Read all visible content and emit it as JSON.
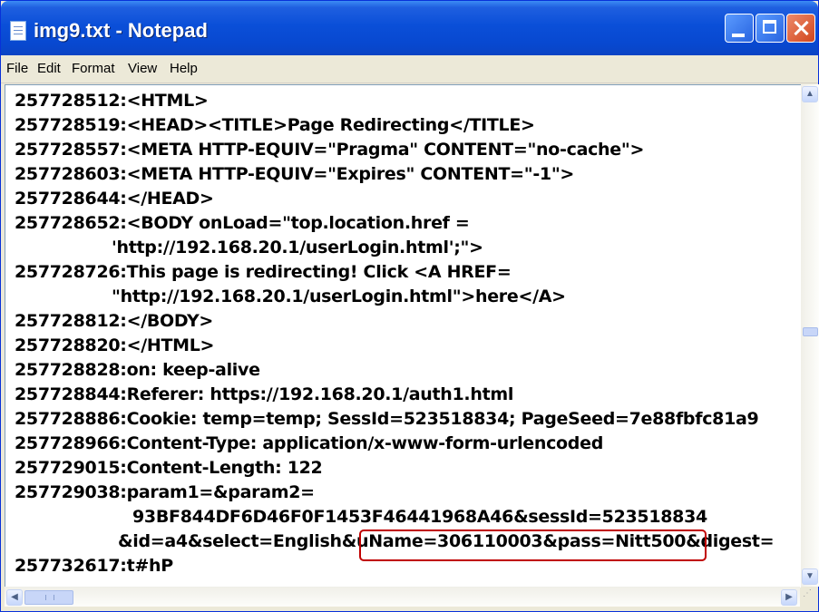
{
  "window": {
    "title": "img9.txt - Notepad"
  },
  "menu": [
    "File",
    "Edit",
    "Format",
    "View",
    "Help"
  ],
  "lines": [
    "257728512:<HTML>",
    "257728519:<HEAD><TITLE>Page Redirecting</TITLE>",
    "257728557:<META HTTP-EQUIV=\"Pragma\" CONTENT=\"no-cache\">",
    "257728603:<META HTTP-EQUIV=\"Expires\" CONTENT=\"-1\">",
    "257728644:</HEAD>",
    "257728652:<BODY onLoad=\"top.location.href =",
    "'http://192.168.20.1/userLogin.html';\">",
    "257728726:This page is redirecting! Click <A HREF=",
    "\"http://192.168.20.1/userLogin.html\">here</A>",
    "257728812:</BODY>",
    "257728820:</HTML>",
    "257728828:on: keep-alive",
    "257728844:Referer: https://192.168.20.1/auth1.html",
    "257728886:Cookie: temp=temp; SessId=523518834; PageSeed=7e88fbfc81a9",
    "257728966:Content-Type: application/x-www-form-urlencoded",
    "257729015:Content-Length: 122",
    "257729038:param1=&param2=",
    "93BF844DF6D46F0F1453F46441968A46&sessId=523518834",
    "&id=a4&select=English&uName=306110003&pass=Nitt500&digest=",
    "257732617:t#hP"
  ],
  "colors": {
    "titlebar": "#0a4fd8",
    "highlight_border": "#c00000",
    "close_button": "#d2461e"
  },
  "icons": [
    "notepad-icon",
    "minimize-icon",
    "maximize-icon",
    "close-icon",
    "scroll-up-icon",
    "scroll-down-icon",
    "scroll-left-icon",
    "scroll-right-icon"
  ]
}
